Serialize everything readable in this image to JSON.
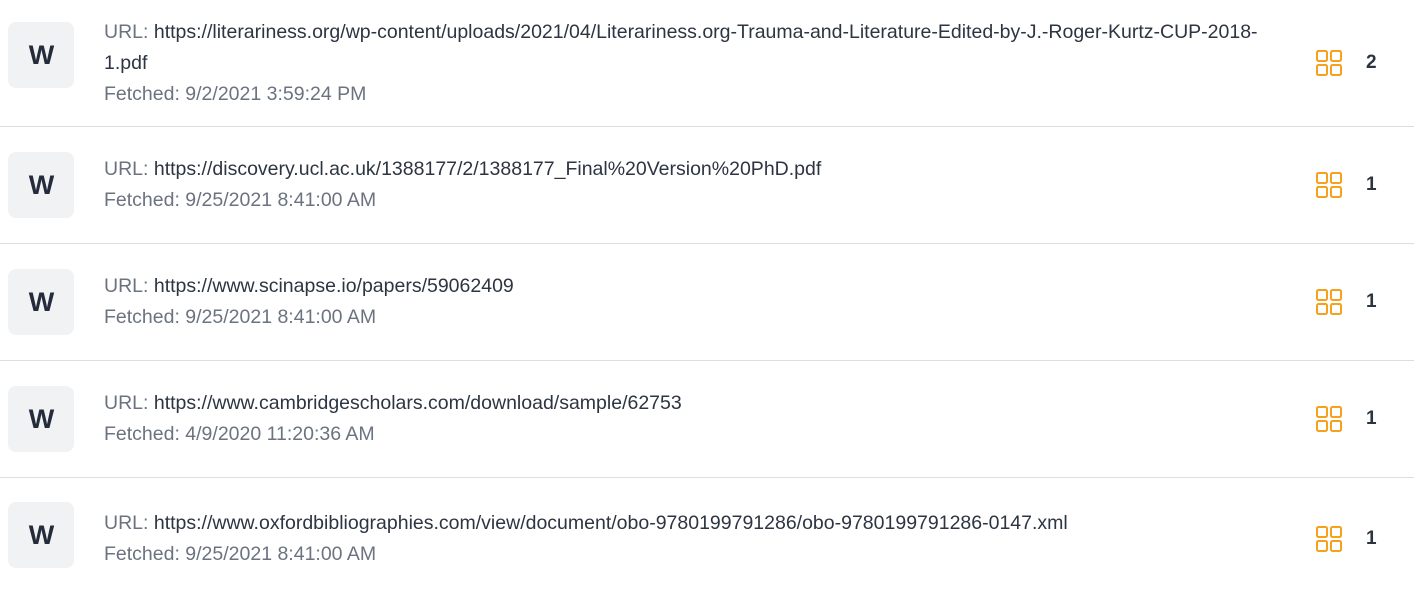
{
  "sources": [
    {
      "badge": "W",
      "url_label": "URL: ",
      "url": "https://literariness.org/wp-content/uploads/2021/04/Literariness.org-Trauma-and-Literature-Edited-by-J.-Roger-Kurtz-CUP-2018-1.pdf",
      "fetched": "Fetched: 9/2/2021 3:59:24 PM",
      "count": "2"
    },
    {
      "badge": "W",
      "url_label": "URL: ",
      "url": "https://discovery.ucl.ac.uk/1388177/2/1388177_Final%20Version%20PhD.pdf",
      "fetched": "Fetched: 9/25/2021 8:41:00 AM",
      "count": "1"
    },
    {
      "badge": "W",
      "url_label": "URL: ",
      "url": "https://www.scinapse.io/papers/59062409",
      "fetched": "Fetched: 9/25/2021 8:41:00 AM",
      "count": "1"
    },
    {
      "badge": "W",
      "url_label": "URL: ",
      "url": "https://www.cambridgescholars.com/download/sample/62753",
      "fetched": "Fetched: 4/9/2020 11:20:36 AM",
      "count": "1"
    },
    {
      "badge": "W",
      "url_label": "URL: ",
      "url": "https://www.oxfordbibliographies.com/view/document/obo-9780199791286/obo-9780199791286-0147.xml",
      "fetched": "Fetched: 9/25/2021 8:41:00 AM",
      "count": "1"
    }
  ],
  "icons": {
    "source_badge": "web-source-icon",
    "compare": "grid-compare-icon"
  },
  "colors": {
    "accent": "#f5a11c",
    "badge_bg": "#f1f2f4",
    "divider": "#dadde2"
  }
}
